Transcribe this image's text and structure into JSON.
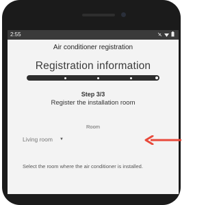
{
  "status_bar": {
    "time": "2:55",
    "icons": [
      "mute-icon",
      "wifi-icon",
      "battery-icon"
    ]
  },
  "app": {
    "title": "Air conditioner registration",
    "heading": "Registration information"
  },
  "progress": {
    "current_step": 3,
    "total_steps": 3
  },
  "step": {
    "label": "Step 3/3",
    "subtitle": "Register the installation room"
  },
  "room_field": {
    "label": "Room",
    "value": "Living room"
  },
  "hint": "Select the room where the air conditioner is installed.",
  "annotation": {
    "arrow_color": "#e8493a"
  }
}
